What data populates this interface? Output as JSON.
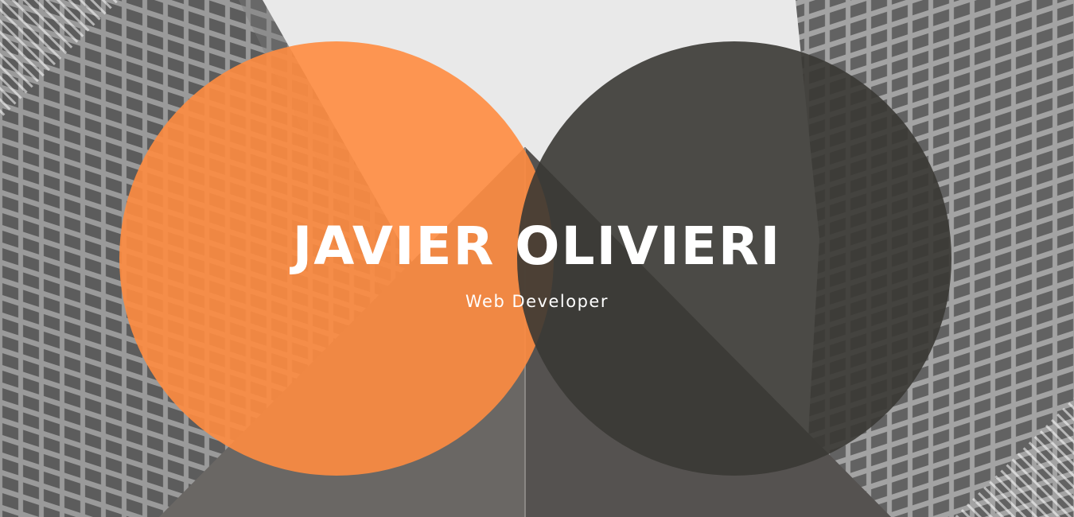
{
  "banner": {
    "name": "JAVIER OLIVIERI",
    "role": "Web Developer"
  },
  "colors": {
    "orange_circle": "#FF8C40",
    "dark_circle": "#3A3834",
    "text": "#FFFFFF",
    "background": "#D9D9D9"
  }
}
